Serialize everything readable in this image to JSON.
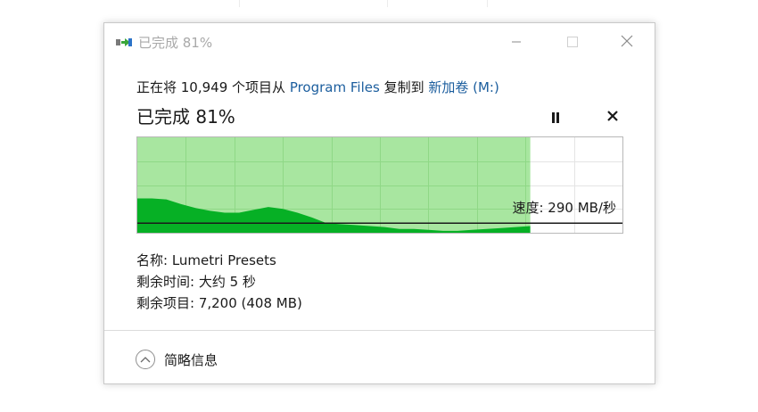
{
  "window": {
    "title": "已完成 81%"
  },
  "copy": {
    "prefix": "正在将 10,949 个项目从",
    "source": "Program Files",
    "middle": "复制到",
    "destination": "新加卷 (M:)"
  },
  "status": {
    "percent_text": "已完成 81%",
    "progress": 0.81
  },
  "graph": {
    "speed_label": "速度: 290 MB/秒",
    "speed_samples": [
      0.36,
      0.36,
      0.35,
      0.3,
      0.26,
      0.23,
      0.21,
      0.21,
      0.24,
      0.27,
      0.25,
      0.21,
      0.16,
      0.1,
      0.09,
      0.08,
      0.07,
      0.06,
      0.04,
      0.04,
      0.03,
      0.02,
      0.02,
      0.03,
      0.04,
      0.05,
      0.06,
      0.07
    ],
    "current_speed_level": 0.1,
    "colors": {
      "progress_fill": "#a8e6a0",
      "speed_fill": "#06b025",
      "grid_done": "#8fd886",
      "grid_remaining": "#e4e4e4",
      "line": "#1a1a1a"
    }
  },
  "details": {
    "name": "名称: Lumetri Presets",
    "time_remaining": "剩余时间: 大约 5 秒",
    "items_remaining": "剩余项目: 7,200 (408 MB)"
  },
  "footer": {
    "collapse_label": "简略信息"
  },
  "icons": {
    "app": "copy-arrow-icon",
    "minimize": "minimize-icon",
    "maximize": "maximize-icon",
    "close": "close-icon",
    "pause": "pause-icon",
    "cancel": "cancel-icon",
    "chevron": "chevron-up-icon"
  }
}
